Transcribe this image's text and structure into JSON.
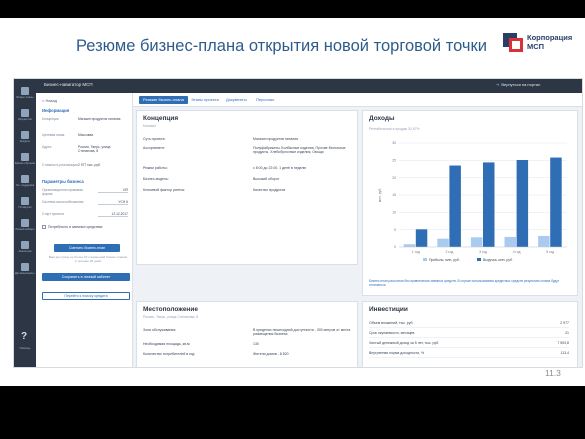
{
  "slide": {
    "title": "Резюме бизнес-плана открытия новой торговой точки",
    "logo_line1": "Корпорация",
    "logo_line2": "МСП",
    "page_number": "11.3"
  },
  "app": {
    "name": "Бизнес-навигатор МСП",
    "back_link": "Вернуться на портал"
  },
  "rail": [
    {
      "icon": "store-icon",
      "label": "Бизнес-планы"
    },
    {
      "icon": "building-icon",
      "label": "Имущество"
    },
    {
      "icon": "credit-icon",
      "label": "Кредиты"
    },
    {
      "icon": "document-icon",
      "label": "Бизнес-обучение"
    },
    {
      "icon": "support-icon",
      "label": "Гос. поддержка"
    },
    {
      "icon": "shopping-icon",
      "label": "Госзакупки"
    },
    {
      "icon": "person-icon",
      "label": "Личный кабинет"
    },
    {
      "icon": "chart-icon",
      "label": "Аналитика"
    },
    {
      "icon": "education-icon",
      "label": "Дистанционное обучение"
    }
  ],
  "help": {
    "icon": "question-icon",
    "label": "Помощь"
  },
  "left_panel": {
    "back": "< Назад",
    "info_title": "Информация",
    "info_rows": [
      {
        "k": "Концепция",
        "v": "Магазин продуктов питания"
      },
      {
        "k": "Целевая ниша",
        "v": "Массовая"
      },
      {
        "k": "Адрес",
        "v": "Россия, Тверь, улица Степанова, 8"
      },
      {
        "k": "Стоимость реализации",
        "v": "2 977 тыс. руб."
      }
    ],
    "params_title": "Параметры бизнеса",
    "params": [
      {
        "k": "Организационно-правовая форма",
        "v": "ИП"
      },
      {
        "k": "Система налогообложения",
        "v": "УСН 6"
      },
      {
        "k": "Старт проекта",
        "v": "12.12.2017"
      }
    ],
    "check_label": "Потребность в заемных средствах",
    "btn_recalc": "Сменить бизнес-план",
    "note": "Вам доступны не более 10 сохранений бизнес-планов в течение 30 дней",
    "btn_save": "Сохранить в личный кабинет",
    "btn_consult": "Перейти к поиску кредита"
  },
  "tabs": [
    "Резюме бизнес-плана",
    "Этапы проекта",
    "Документы",
    "Персонал"
  ],
  "concept": {
    "title": "Концепция",
    "subtitle": "Магазин",
    "rows": [
      {
        "k": "Суть проекта:",
        "v": "Магазин продуктов питания"
      },
      {
        "k": "Ассортимент:",
        "v": "Полуфабрикаты, Колбасные изделия, Прочие Молочные продукты, Хлебобулочные изделия, Овощи"
      },
      {
        "k": "Режим работы:",
        "v": "с 8:00 до 22:00, 1 денё в неделю"
      },
      {
        "k": "Бизнес-модель:",
        "v": "Высокий оборот"
      },
      {
        "k": "Ключевой фактор успеха:",
        "v": "Качество продуктов"
      }
    ]
  },
  "income": {
    "title": "Доходы",
    "subtitle": "Рентабельность продаж 32,67%",
    "note": "Бизнес-план рассчитан без привлечения заемных средств. В случае использования кредитных средств результаты плана будут отличаться"
  },
  "location": {
    "title": "Местоположение",
    "subtitle": "Россия, Тверь, улица Степанова, 8",
    "rows": [
      {
        "k": "Зона обслуживания:",
        "v": "В пределах пешеходной доступности - 300 метров от места размещения бизнеса"
      },
      {
        "k": "Необходимая площадь, кв.м:",
        "v": "130"
      },
      {
        "k": "Количество потребителей в год:",
        "v": "Жители домов - 8 820"
      }
    ]
  },
  "investments": {
    "title": "Инвестиции",
    "rows": [
      {
        "k": "Объем вложений, тыс. руб.",
        "v": "2 977"
      },
      {
        "k": "Срок окупаемости, месяцев",
        "v": "21"
      },
      {
        "k": "Чистый денежный доход за 5 лет, тыс. руб.",
        "v": "7 593,8"
      },
      {
        "k": "Внутренняя норма доходности, %",
        "v": "113,4"
      }
    ]
  },
  "colors": {
    "primary": "#2f6db5",
    "light": "#a9cbef",
    "rail": "#2c3645"
  },
  "chart_data": {
    "type": "bar",
    "categories": [
      "1 год",
      "2 год",
      "3 год",
      "4 год",
      "5 год"
    ],
    "series": [
      {
        "name": "Прибыль, млн. руб.",
        "values": [
          0.8,
          2.4,
          2.8,
          2.9,
          3.2
        ]
      },
      {
        "name": "Выручка, млн. руб.",
        "values": [
          5.1,
          23.5,
          24.4,
          25.1,
          25.8
        ]
      }
    ],
    "ylabel": "млн. руб.",
    "ylim": [
      0,
      30
    ],
    "yticks": [
      "0",
      "5",
      "10",
      "15",
      "20",
      "25",
      "30"
    ],
    "grid": true,
    "legend_position": "bottom"
  }
}
